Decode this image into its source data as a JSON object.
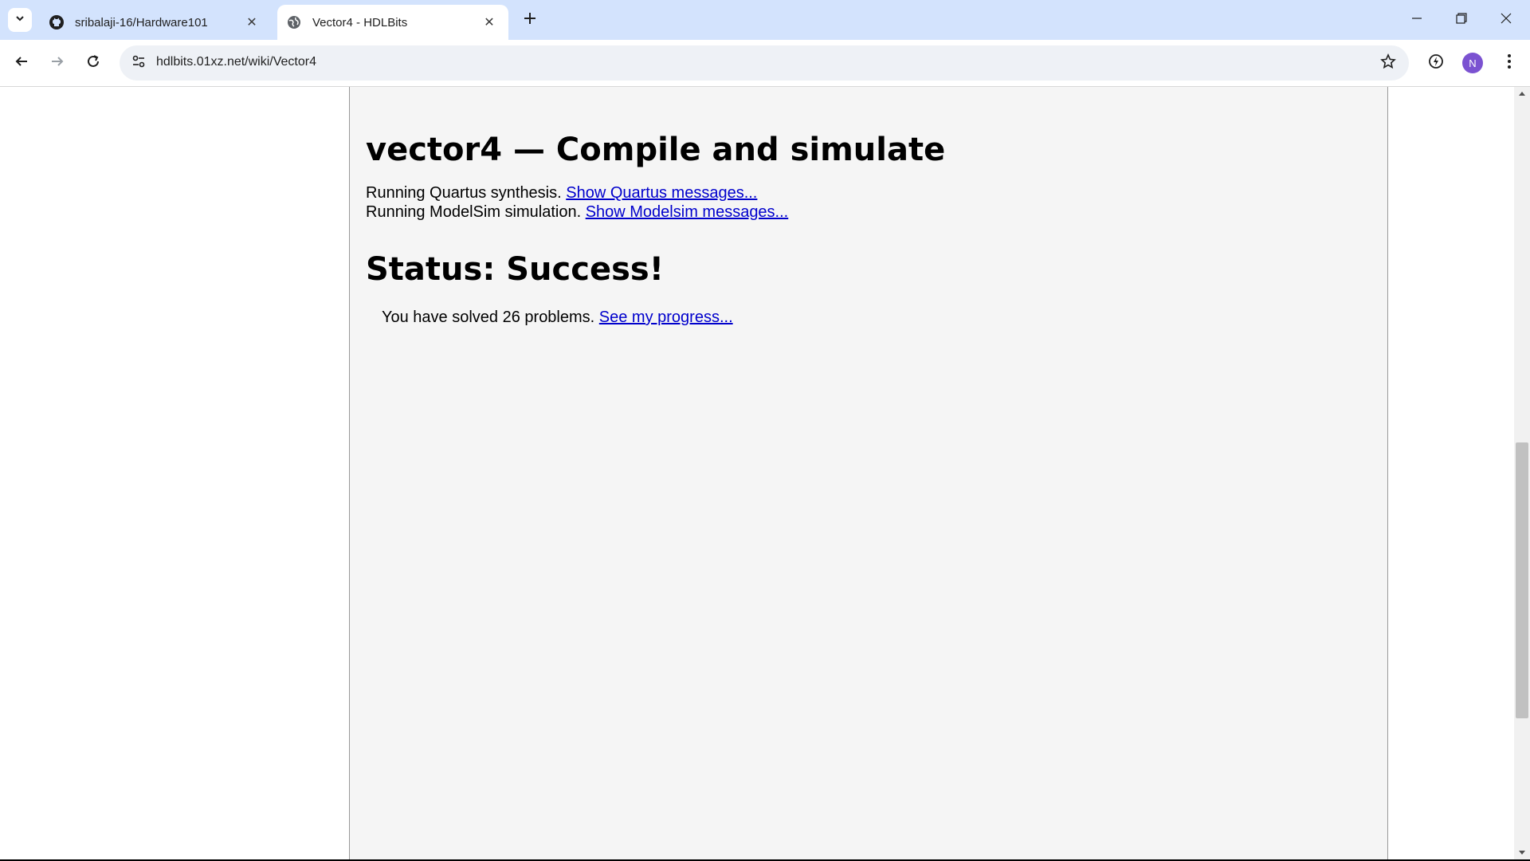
{
  "browser": {
    "tabs": [
      {
        "title": "sribalaji-16/Hardware101",
        "icon": "github-icon",
        "active": false
      },
      {
        "title": "Vector4 - HDLBits",
        "icon": "globe-icon",
        "active": true
      }
    ],
    "url": "hdlbits.01xz.net/wiki/Vector4",
    "avatar_initial": "N",
    "avatar_color": "#7b52d1",
    "tabstrip_color": "#d3e3fd"
  },
  "page": {
    "heading": "vector4 — Compile and simulate",
    "quartus": {
      "text": "Running Quartus synthesis. ",
      "link": "Show Quartus messages..."
    },
    "modelsim": {
      "text": "Running ModelSim simulation. ",
      "link": "Show Modelsim messages..."
    },
    "status": "Status: Success!",
    "progress": {
      "text": "You have solved 26 problems. ",
      "link": "See my progress..."
    },
    "link_color": "#0000cc"
  }
}
